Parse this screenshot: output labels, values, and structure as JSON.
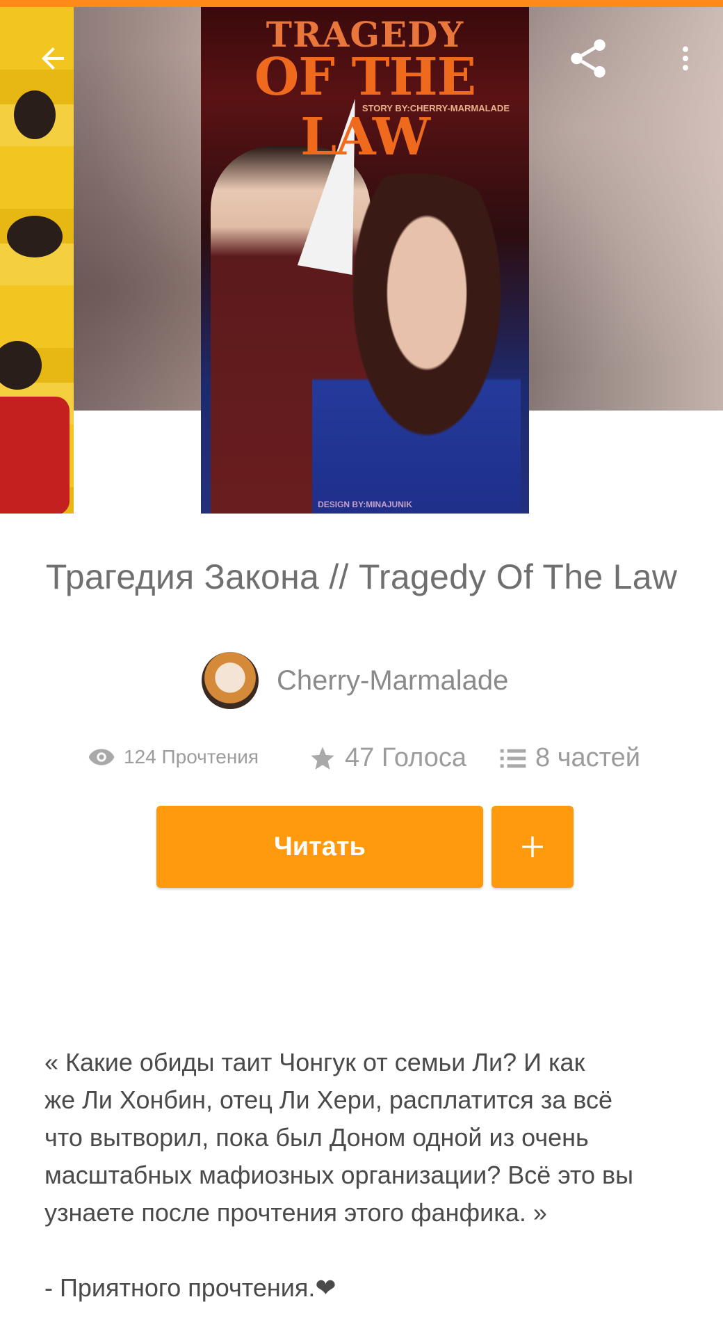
{
  "app": {
    "accent_color": "#ff9a0f",
    "top_bar_color": "#ff8a1a"
  },
  "toolbar": {
    "back_icon": "arrow-left-icon",
    "share_icon": "share-icon",
    "more_icon": "more-vertical-icon"
  },
  "cover": {
    "title_line1": "TRAGEDY",
    "title_line2": "OF THE LAW",
    "byline": "STORY BY:CHERRY-MARMALADE",
    "footer": "DESIGN BY:MINAJUNIK"
  },
  "story": {
    "title": "Трагедия Закона // Tragedy Of The Law",
    "author": "Cherry-Marmalade",
    "stats": {
      "reads": "124 Прочтения",
      "votes": "47 Голоса",
      "parts": "8 частей"
    },
    "read_button": "Читать",
    "add_button": "+",
    "description": {
      "line1": "« Какие обиды таит Чонгук от семьи Ли? И как",
      "line2": "же Ли Хонбин, отец Ли Хери, расплатится за всё",
      "line3": "что вытворил, пока был Доном одной из очень",
      "line4": "масштабных мафиозных организации? Всё это вы",
      "line5": "узнаете после прочтения этого фанфика. »",
      "line6": "- Приятного прочтения.❤"
    }
  }
}
